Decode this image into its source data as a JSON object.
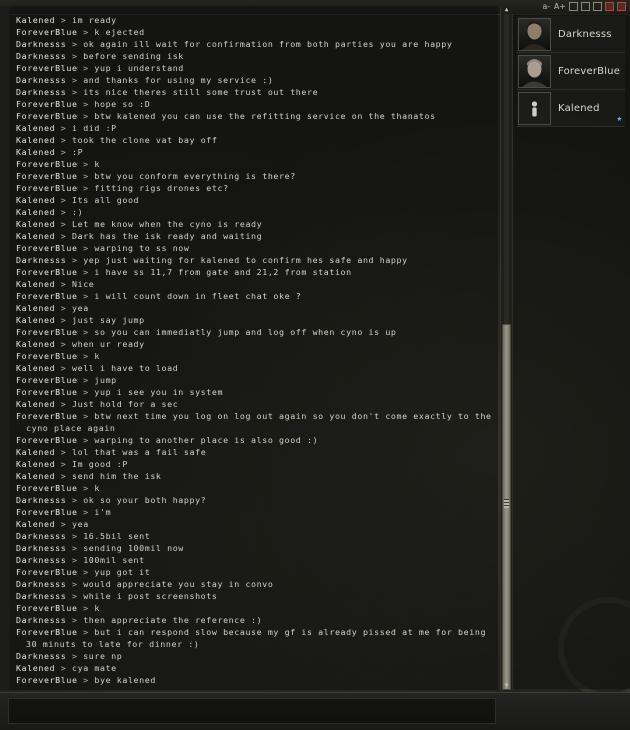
{
  "toolbar": {
    "font_smaller": "a-",
    "font_larger": "A+"
  },
  "members": [
    {
      "name": "Darknesss"
    },
    {
      "name": "ForeverBlue"
    },
    {
      "name": "Kalened"
    }
  ],
  "messages": [
    {
      "from": "Kalened",
      "text": "im ready"
    },
    {
      "from": "ForeverBlue",
      "text": "k ejected"
    },
    {
      "from": "Darknesss",
      "text": "ok again ill wait for confirmation from both parties you are happy"
    },
    {
      "from": "Darknesss",
      "text": "before sending isk"
    },
    {
      "from": "ForeverBlue",
      "text": "yup i understand"
    },
    {
      "from": "Darknesss",
      "text": "and thanks for using my service :)"
    },
    {
      "from": "Darknesss",
      "text": "its nice theres still some trust out there"
    },
    {
      "from": "ForeverBlue",
      "text": "hope so :D"
    },
    {
      "from": "ForeverBlue",
      "text": "btw kalened you can use the refitting service on the thanatos"
    },
    {
      "from": "Kalened",
      "text": "i did :P"
    },
    {
      "from": "Kalened",
      "text": "took the clone vat bay off"
    },
    {
      "from": "Kalened",
      "text": ":P"
    },
    {
      "from": "ForeverBlue",
      "text": "k"
    },
    {
      "from": "ForeverBlue",
      "text": "btw you conform everything is there?"
    },
    {
      "from": "ForeverBlue",
      "text": "fitting rigs drones etc?"
    },
    {
      "from": "Kalened",
      "text": "Its all good"
    },
    {
      "from": "Kalened",
      "text": ":)"
    },
    {
      "from": "Kalened",
      "text": "Let me know when the cyno is ready"
    },
    {
      "from": "Kalened",
      "text": "Dark has the isk ready and waiting"
    },
    {
      "from": "ForeverBlue",
      "text": "warping to ss now"
    },
    {
      "from": "Darknesss",
      "text": "yep just waiting for kalened to confirm hes safe and happy"
    },
    {
      "from": "ForeverBlue",
      "text": "i have ss 11,7 from gate and 21,2 from station"
    },
    {
      "from": "Kalened",
      "text": "Nice"
    },
    {
      "from": "ForeverBlue",
      "text": "i will count down in fleet chat oke ?"
    },
    {
      "from": "Kalened",
      "text": "yea"
    },
    {
      "from": "Kalened",
      "text": "just say jump"
    },
    {
      "from": "ForeverBlue",
      "text": "so you can immediatly jump and log off when cyno is up"
    },
    {
      "from": "Kalened",
      "text": "when ur ready"
    },
    {
      "from": "ForeverBlue",
      "text": "k"
    },
    {
      "from": "Kalened",
      "text": "well i have to load"
    },
    {
      "from": "ForeverBlue",
      "text": "jump"
    },
    {
      "from": "ForeverBlue",
      "text": "yup i see you in system"
    },
    {
      "from": "Kalened",
      "text": "Just hold for a sec"
    },
    {
      "from": "ForeverBlue",
      "text": "btw next time you log on log out again so you don't come exactly to the",
      "cont": "cyno place again"
    },
    {
      "from": "ForeverBlue",
      "text": "warping to another place is also good :)"
    },
    {
      "from": "Kalened",
      "text": "lol that was a fail safe"
    },
    {
      "from": "Kalened",
      "text": "Im good :P"
    },
    {
      "from": "Kalened",
      "text": "send him the isk"
    },
    {
      "from": "ForeverBlue",
      "text": "k"
    },
    {
      "from": "Darknesss",
      "text": "ok so your both happy?"
    },
    {
      "from": "ForeverBlue",
      "text": "i'm"
    },
    {
      "from": "Kalened",
      "text": "yea"
    },
    {
      "from": "Darknesss",
      "text": "16.5bil sent"
    },
    {
      "from": "Darknesss",
      "text": "sending 100mil now"
    },
    {
      "from": "Darknesss",
      "text": "100mil sent"
    },
    {
      "from": "ForeverBlue",
      "text": "yup got it"
    },
    {
      "from": "Darknesss",
      "text": "would appreciate you stay in convo"
    },
    {
      "from": "Darknesss",
      "text": "while i post screenshots"
    },
    {
      "from": "ForeverBlue",
      "text": "k"
    },
    {
      "from": "Darknesss",
      "text": "then appreciate the reference :)"
    },
    {
      "from": "ForeverBlue",
      "text": "but i can respond slow because my gf is already pissed at me for being",
      "cont": "30 minuts to late for dinner :)"
    },
    {
      "from": "Darknesss",
      "text": "sure np"
    },
    {
      "from": "Kalened",
      "text": "cya mate"
    },
    {
      "from": "ForeverBlue",
      "text": "bye kalened"
    }
  ],
  "separator": ">",
  "input": {
    "value": ""
  },
  "colors": {
    "chat_text": "#d4d4ca",
    "star": "#7fa8ff",
    "background": "#161613"
  }
}
